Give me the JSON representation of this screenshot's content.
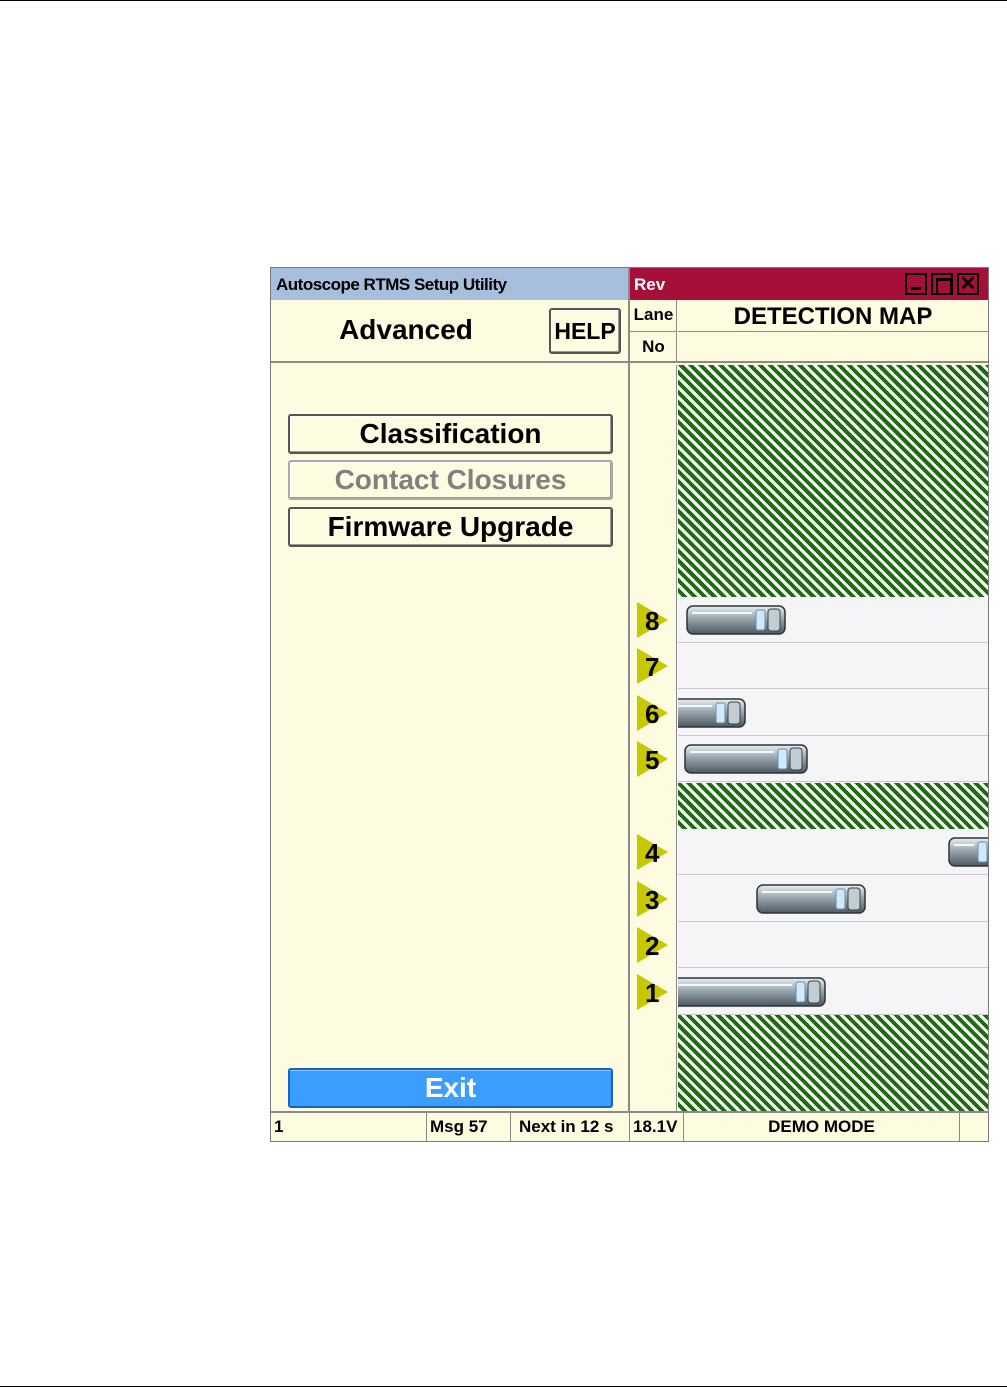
{
  "left_window": {
    "title": "Autoscope RTMS Setup Utility",
    "screen_title": "Advanced",
    "help_label": "HELP",
    "menu": [
      {
        "label": "Classification",
        "enabled": true
      },
      {
        "label": "Contact Closures",
        "enabled": false
      },
      {
        "label": "Firmware Upgrade",
        "enabled": true
      }
    ],
    "exit_label": "Exit"
  },
  "right_window": {
    "title": "Rev",
    "close_glyph": "✕",
    "lane_header_top": "Lane",
    "lane_header_bottom": "No",
    "map_title": "DETECTION MAP",
    "lanes": [
      {
        "number": "8",
        "vehicle": "van"
      },
      {
        "number": "7",
        "vehicle": "none"
      },
      {
        "number": "6",
        "vehicle": "van"
      },
      {
        "number": "5",
        "vehicle": "van"
      },
      {
        "number": "4",
        "vehicle": "van"
      },
      {
        "number": "3",
        "vehicle": "van"
      },
      {
        "number": "2",
        "vehicle": "none"
      },
      {
        "number": "1",
        "vehicle": "truck"
      }
    ]
  },
  "status": {
    "cell1": "1",
    "cell2": "Msg 57",
    "cell3": "Next in 12 s",
    "cell4": "18.1V",
    "cell5": "DEMO MODE"
  },
  "colors": {
    "left_title_bar": "#a7bedc",
    "right_title_bar": "#a50f3a",
    "panel_background": "#fdfbe0",
    "hatch_green": "#1f6b12",
    "exit_button": "#3b9eff",
    "lane_marker": "#c8c800"
  },
  "icons": [
    "minimize-icon",
    "maximize-icon",
    "close-icon",
    "lane-marker-icon",
    "vehicle-icon",
    "hatch-pattern"
  ]
}
